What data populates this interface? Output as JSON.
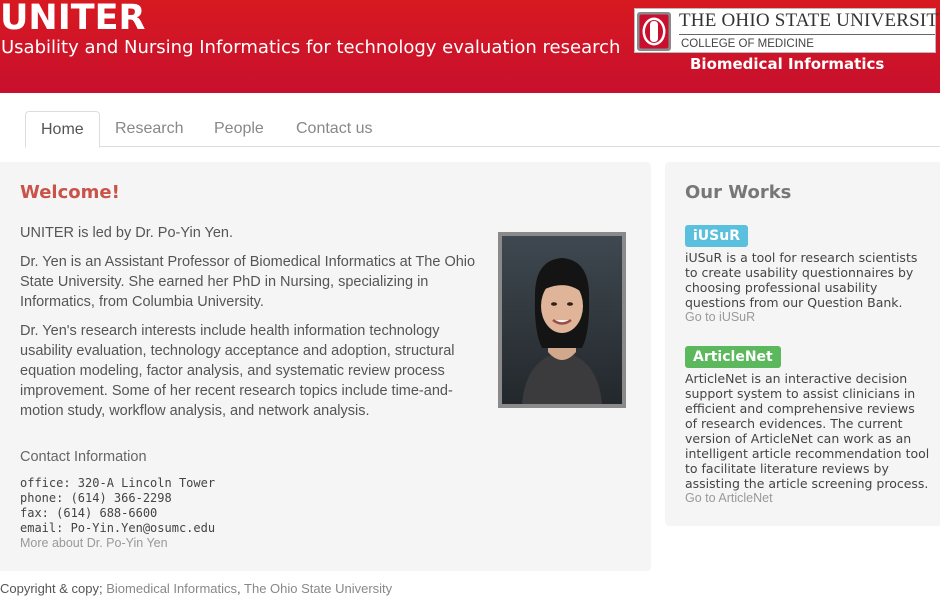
{
  "header": {
    "title": "UNITER",
    "subtitle": "Usability and Nursing Informatics for technology evaluation research",
    "university": "THE OHIO STATE UNIVERSITY",
    "college": "COLLEGE OF MEDICINE",
    "department": "Biomedical Informatics",
    "logo_letter": "O",
    "colors": {
      "brand_red": "#c8102e",
      "logo_gray": "#888888"
    }
  },
  "nav": {
    "tabs": [
      {
        "label": "Home",
        "active": true
      },
      {
        "label": "Research",
        "active": false
      },
      {
        "label": "People",
        "active": false
      },
      {
        "label": "Contact us",
        "active": false
      }
    ]
  },
  "main": {
    "heading": "Welcome!",
    "paragraphs": [
      "UNITER is led by Dr. Po-Yin Yen.",
      "Dr. Yen is an Assistant Professor of Biomedical Informatics at The Ohio State University. She earned her PhD in Nursing, specializing in Informatics, from Columbia University.",
      "Dr. Yen's research interests include health information technology usability evaluation, technology acceptance and adoption, structural equation modeling, factor analysis, and systematic review process improvement. Some of her recent research topics include time-and-motion study, workflow analysis, and network analysis."
    ],
    "contact": {
      "title": "Contact Information",
      "office": "office: 320-A Lincoln Tower",
      "phone": "phone: (614) 366-2298",
      "fax": "fax: (614) 688-6600",
      "email": "email: Po-Yin.Yen@osumc.edu",
      "more_link": "More about Dr. Po-Yin Yen"
    }
  },
  "works": {
    "title": "Our Works",
    "items": [
      {
        "badge": "iUSuR",
        "badge_color": "#5bc0de",
        "description": "iUSuR is a tool for research scientists to create usability questionnaires by choosing professional usability questions from our Question Bank.",
        "link": "Go to iUSuR"
      },
      {
        "badge": "ArticleNet",
        "badge_color": "#5cb85c",
        "description": "ArticleNet is an interactive decision support system to assist clinicians in efficient and comprehensive reviews of research evidences. The current version of ArticleNet can work as an intelligent article recommendation tool to facilitate literature reviews by assisting the article screening process.",
        "link": "Go to ArticleNet"
      }
    ]
  },
  "footer": {
    "prefix": "Copyright & copy;",
    "link1": "Biomedical Informatics",
    "separator": ",",
    "link2": "The Ohio State University"
  }
}
